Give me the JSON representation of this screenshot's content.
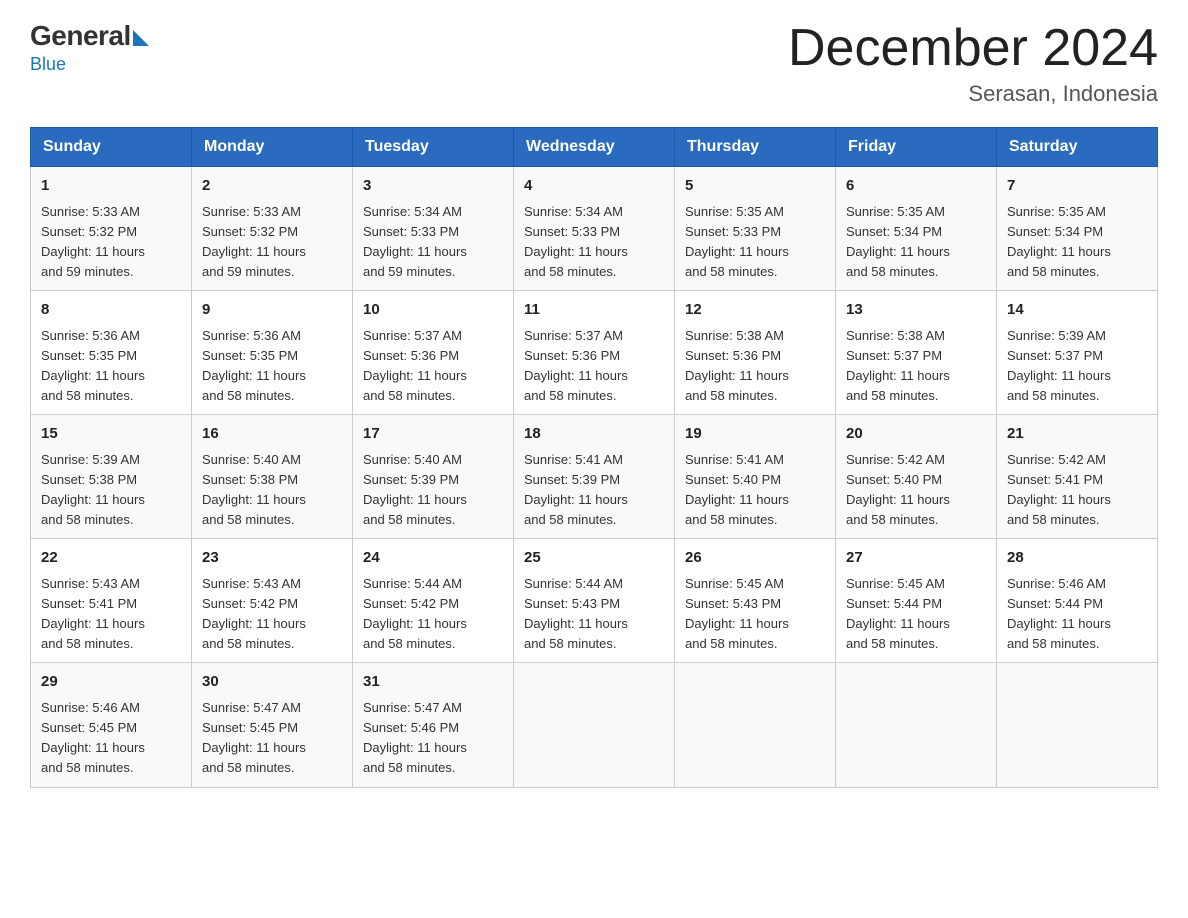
{
  "logo": {
    "general": "General",
    "blue": "Blue"
  },
  "header": {
    "title": "December 2024",
    "subtitle": "Serasan, Indonesia"
  },
  "days_of_week": [
    "Sunday",
    "Monday",
    "Tuesday",
    "Wednesday",
    "Thursday",
    "Friday",
    "Saturday"
  ],
  "weeks": [
    [
      {
        "day": "1",
        "sunrise": "5:33 AM",
        "sunset": "5:32 PM",
        "daylight": "11 hours and 59 minutes."
      },
      {
        "day": "2",
        "sunrise": "5:33 AM",
        "sunset": "5:32 PM",
        "daylight": "11 hours and 59 minutes."
      },
      {
        "day": "3",
        "sunrise": "5:34 AM",
        "sunset": "5:33 PM",
        "daylight": "11 hours and 59 minutes."
      },
      {
        "day": "4",
        "sunrise": "5:34 AM",
        "sunset": "5:33 PM",
        "daylight": "11 hours and 58 minutes."
      },
      {
        "day": "5",
        "sunrise": "5:35 AM",
        "sunset": "5:33 PM",
        "daylight": "11 hours and 58 minutes."
      },
      {
        "day": "6",
        "sunrise": "5:35 AM",
        "sunset": "5:34 PM",
        "daylight": "11 hours and 58 minutes."
      },
      {
        "day": "7",
        "sunrise": "5:35 AM",
        "sunset": "5:34 PM",
        "daylight": "11 hours and 58 minutes."
      }
    ],
    [
      {
        "day": "8",
        "sunrise": "5:36 AM",
        "sunset": "5:35 PM",
        "daylight": "11 hours and 58 minutes."
      },
      {
        "day": "9",
        "sunrise": "5:36 AM",
        "sunset": "5:35 PM",
        "daylight": "11 hours and 58 minutes."
      },
      {
        "day": "10",
        "sunrise": "5:37 AM",
        "sunset": "5:36 PM",
        "daylight": "11 hours and 58 minutes."
      },
      {
        "day": "11",
        "sunrise": "5:37 AM",
        "sunset": "5:36 PM",
        "daylight": "11 hours and 58 minutes."
      },
      {
        "day": "12",
        "sunrise": "5:38 AM",
        "sunset": "5:36 PM",
        "daylight": "11 hours and 58 minutes."
      },
      {
        "day": "13",
        "sunrise": "5:38 AM",
        "sunset": "5:37 PM",
        "daylight": "11 hours and 58 minutes."
      },
      {
        "day": "14",
        "sunrise": "5:39 AM",
        "sunset": "5:37 PM",
        "daylight": "11 hours and 58 minutes."
      }
    ],
    [
      {
        "day": "15",
        "sunrise": "5:39 AM",
        "sunset": "5:38 PM",
        "daylight": "11 hours and 58 minutes."
      },
      {
        "day": "16",
        "sunrise": "5:40 AM",
        "sunset": "5:38 PM",
        "daylight": "11 hours and 58 minutes."
      },
      {
        "day": "17",
        "sunrise": "5:40 AM",
        "sunset": "5:39 PM",
        "daylight": "11 hours and 58 minutes."
      },
      {
        "day": "18",
        "sunrise": "5:41 AM",
        "sunset": "5:39 PM",
        "daylight": "11 hours and 58 minutes."
      },
      {
        "day": "19",
        "sunrise": "5:41 AM",
        "sunset": "5:40 PM",
        "daylight": "11 hours and 58 minutes."
      },
      {
        "day": "20",
        "sunrise": "5:42 AM",
        "sunset": "5:40 PM",
        "daylight": "11 hours and 58 minutes."
      },
      {
        "day": "21",
        "sunrise": "5:42 AM",
        "sunset": "5:41 PM",
        "daylight": "11 hours and 58 minutes."
      }
    ],
    [
      {
        "day": "22",
        "sunrise": "5:43 AM",
        "sunset": "5:41 PM",
        "daylight": "11 hours and 58 minutes."
      },
      {
        "day": "23",
        "sunrise": "5:43 AM",
        "sunset": "5:42 PM",
        "daylight": "11 hours and 58 minutes."
      },
      {
        "day": "24",
        "sunrise": "5:44 AM",
        "sunset": "5:42 PM",
        "daylight": "11 hours and 58 minutes."
      },
      {
        "day": "25",
        "sunrise": "5:44 AM",
        "sunset": "5:43 PM",
        "daylight": "11 hours and 58 minutes."
      },
      {
        "day": "26",
        "sunrise": "5:45 AM",
        "sunset": "5:43 PM",
        "daylight": "11 hours and 58 minutes."
      },
      {
        "day": "27",
        "sunrise": "5:45 AM",
        "sunset": "5:44 PM",
        "daylight": "11 hours and 58 minutes."
      },
      {
        "day": "28",
        "sunrise": "5:46 AM",
        "sunset": "5:44 PM",
        "daylight": "11 hours and 58 minutes."
      }
    ],
    [
      {
        "day": "29",
        "sunrise": "5:46 AM",
        "sunset": "5:45 PM",
        "daylight": "11 hours and 58 minutes."
      },
      {
        "day": "30",
        "sunrise": "5:47 AM",
        "sunset": "5:45 PM",
        "daylight": "11 hours and 58 minutes."
      },
      {
        "day": "31",
        "sunrise": "5:47 AM",
        "sunset": "5:46 PM",
        "daylight": "11 hours and 58 minutes."
      },
      null,
      null,
      null,
      null
    ]
  ],
  "labels": {
    "sunrise": "Sunrise:",
    "sunset": "Sunset:",
    "daylight": "Daylight:"
  },
  "colors": {
    "header_bg": "#2a6bbf",
    "header_text": "#ffffff",
    "border": "#cccccc"
  }
}
